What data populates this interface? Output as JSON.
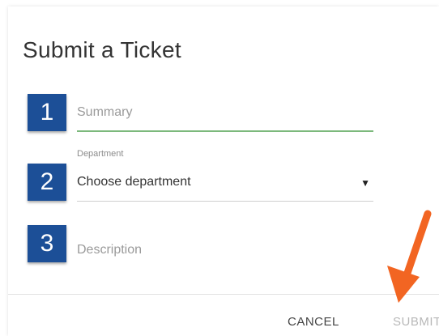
{
  "dialog": {
    "title": "Submit a Ticket"
  },
  "steps": [
    {
      "number": "1"
    },
    {
      "number": "2"
    },
    {
      "number": "3"
    }
  ],
  "fields": {
    "summary_placeholder": "Summary",
    "department_label": "Department",
    "department_value": "Choose department",
    "description_placeholder": "Description"
  },
  "footer": {
    "cancel_label": "CANCEL",
    "submit_label": "SUBMIT"
  },
  "colors": {
    "badge": "#1c4f97",
    "active_underline": "#7cb97c",
    "annotation_arrow": "#f26522"
  },
  "icons": {
    "dropdown": "caret-down-icon",
    "annotation": "arrow-pointer-icon"
  }
}
